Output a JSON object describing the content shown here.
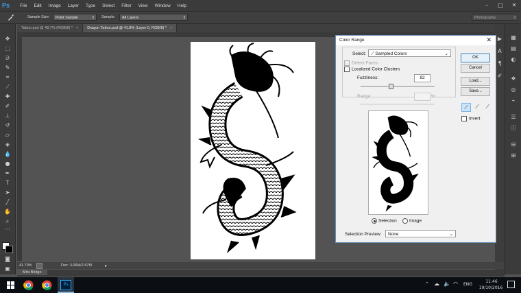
{
  "app": {
    "logo": "Ps"
  },
  "menubar": {
    "items": [
      "File",
      "Edit",
      "Image",
      "Layer",
      "Type",
      "Select",
      "Filter",
      "View",
      "Window",
      "Help"
    ],
    "window_controls": [
      "–",
      "□",
      "✕"
    ]
  },
  "options": {
    "sample_size_label": "Sample Size:",
    "sample_size_value": "Point Sample",
    "sample_label": "Sample:",
    "sample_value": "All Layers",
    "workspace": "Photography"
  },
  "tabs": [
    {
      "label": "Tattoo.psd @ 48.7% (RGB/8) *",
      "active": false
    },
    {
      "label": "Dragon Tattoo.psd @ 41.8% (Layer 0, RGB/8) *",
      "active": true
    }
  ],
  "status": {
    "zoom": "41.79%",
    "doc": "Doc: 3.06M/2.87M"
  },
  "panel_bottom": {
    "mini_bridge": "Mini Bridge"
  },
  "dialog": {
    "title": "Color Range",
    "select_label": "Select:",
    "select_value": "Sampled Colors",
    "detect_faces": "Detect Faces",
    "localized": "Localized Color Clusters",
    "fuzziness_label": "Fuzziness:",
    "fuzziness_value": "82",
    "fuzziness_fraction": 0.41,
    "range_label": "Range:",
    "range_unit": "%",
    "ok": "OK",
    "cancel": "Cancel",
    "load": "Load...",
    "save": "Save...",
    "invert": "Invert",
    "radio_selection": "Selection",
    "radio_image": "Image",
    "preview_label": "Selection Preview:",
    "preview_value": "None"
  },
  "taskbar": {
    "language": "ENG",
    "time": "11:46",
    "date": "19/10/2016"
  }
}
